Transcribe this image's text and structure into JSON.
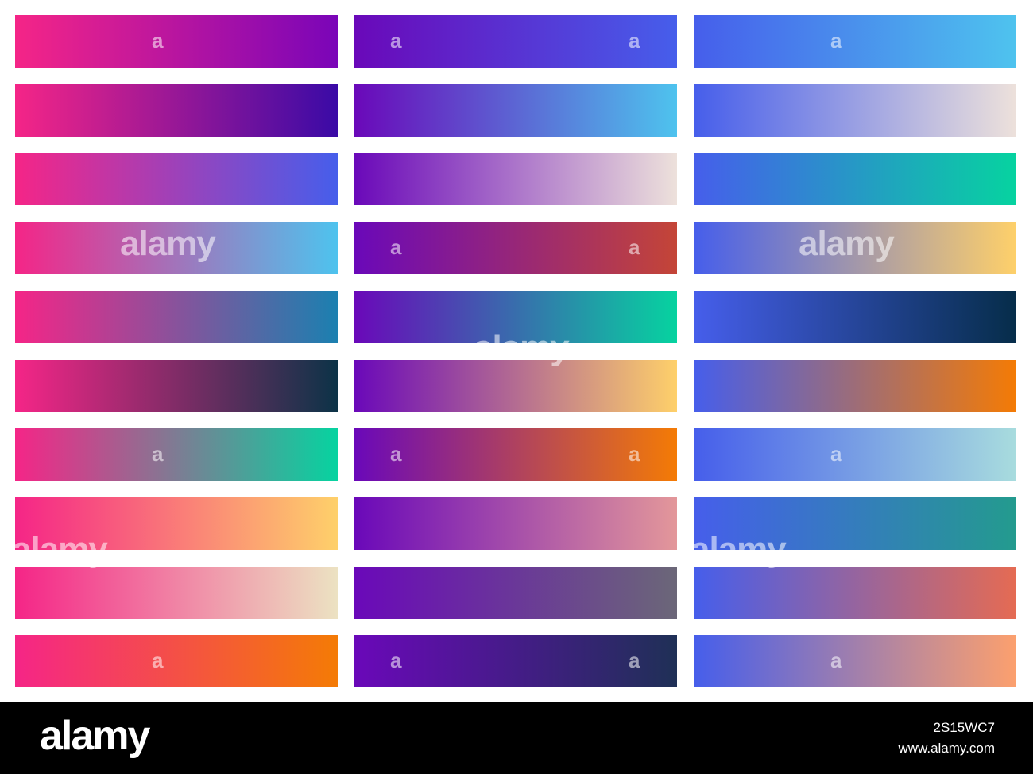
{
  "watermark": {
    "small": "a",
    "large": "alamy"
  },
  "footer": {
    "logo": "alamy",
    "image_id": "2S15WC7",
    "url": "www.alamy.com"
  },
  "columns": [
    {
      "swatches": [
        {
          "from": "#F52587",
          "to": "#7A05B8"
        },
        {
          "from": "#F52587",
          "to": "#3A0AA6"
        },
        {
          "from": "#F52587",
          "to": "#465EEB"
        },
        {
          "from": "#F52587",
          "to": "#4EC3EE"
        },
        {
          "from": "#F52587",
          "to": "#1B80B0"
        },
        {
          "from": "#F52587",
          "to": "#0C3347"
        },
        {
          "from": "#F52587",
          "to": "#06D3A0"
        },
        {
          "from": "#F52587",
          "to": "#FED06A"
        },
        {
          "from": "#F52587",
          "to": "#ECE2C2"
        },
        {
          "from": "#F52587",
          "to": "#F47B05"
        }
      ]
    },
    {
      "swatches": [
        {
          "from": "#6A08B9",
          "to": "#465EEB"
        },
        {
          "from": "#6A08B9",
          "to": "#4EC3EE"
        },
        {
          "from": "#6A08B9",
          "to": "#EDE1DB"
        },
        {
          "from": "#6A08B9",
          "to": "#C44537"
        },
        {
          "from": "#6A08B9",
          "to": "#06D3A0"
        },
        {
          "from": "#6A08B9",
          "to": "#FED06A"
        },
        {
          "from": "#6A08B9",
          "to": "#F47B05"
        },
        {
          "from": "#6A08B9",
          "to": "#E3979A"
        },
        {
          "from": "#6A08B9",
          "to": "#6B6778"
        },
        {
          "from": "#6A08B9",
          "to": "#1F3056"
        }
      ]
    },
    {
      "swatches": [
        {
          "from": "#465EEB",
          "to": "#4EC3EE"
        },
        {
          "from": "#465EEB",
          "to": "#EDE1DB"
        },
        {
          "from": "#465EEB",
          "to": "#06D3A0"
        },
        {
          "from": "#465EEB",
          "to": "#FED06A"
        },
        {
          "from": "#465EEB",
          "to": "#062D4A"
        },
        {
          "from": "#465EEB",
          "to": "#F47B05"
        },
        {
          "from": "#465EEB",
          "to": "#A8DCDE"
        },
        {
          "from": "#465EEB",
          "to": "#239B8E"
        },
        {
          "from": "#465EEB",
          "to": "#E56B53"
        },
        {
          "from": "#465EEB",
          "to": "#FCA06E"
        }
      ]
    }
  ],
  "watermarks": [
    {
      "kind": "small",
      "col": 0,
      "row": 0,
      "pos": "mid"
    },
    {
      "kind": "small",
      "col": 1,
      "row": 0,
      "pos": "left"
    },
    {
      "kind": "small",
      "col": 1,
      "row": 0,
      "pos": "right"
    },
    {
      "kind": "small",
      "col": 2,
      "row": 0,
      "pos": "mid"
    },
    {
      "kind": "large",
      "col": 0,
      "row": 3,
      "pos": "mid"
    },
    {
      "kind": "small",
      "col": 1,
      "row": 3,
      "pos": "left"
    },
    {
      "kind": "small",
      "col": 1,
      "row": 3,
      "pos": "right"
    },
    {
      "kind": "large",
      "col": 2,
      "row": 3,
      "pos": "mid"
    },
    {
      "kind": "large",
      "col": 1,
      "row": 5,
      "pos": "top"
    },
    {
      "kind": "small",
      "col": 0,
      "row": 6,
      "pos": "mid"
    },
    {
      "kind": "small",
      "col": 1,
      "row": 6,
      "pos": "left"
    },
    {
      "kind": "small",
      "col": 1,
      "row": 6,
      "pos": "right"
    },
    {
      "kind": "small",
      "col": 2,
      "row": 6,
      "pos": "mid"
    },
    {
      "kind": "large",
      "col": 0,
      "row": 8,
      "pos": "edge"
    },
    {
      "kind": "large",
      "col": 2,
      "row": 8,
      "pos": "edge"
    },
    {
      "kind": "small",
      "col": 0,
      "row": 9,
      "pos": "mid"
    },
    {
      "kind": "small",
      "col": 1,
      "row": 9,
      "pos": "left"
    },
    {
      "kind": "small",
      "col": 1,
      "row": 9,
      "pos": "right"
    },
    {
      "kind": "small",
      "col": 2,
      "row": 9,
      "pos": "mid"
    }
  ]
}
